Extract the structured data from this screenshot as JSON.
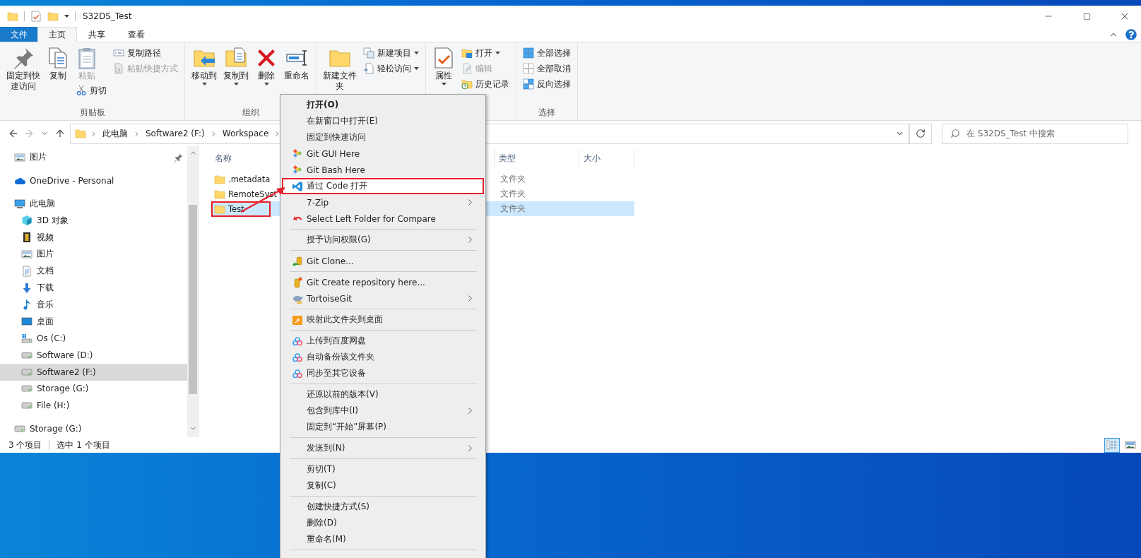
{
  "window": {
    "title": "S32DS_Test"
  },
  "tabs": [
    {
      "label": "文件",
      "kind": "file",
      "selected": false
    },
    {
      "label": "主页",
      "kind": "tab",
      "selected": true
    },
    {
      "label": "共享",
      "kind": "tab",
      "selected": false
    },
    {
      "label": "查看",
      "kind": "tab",
      "selected": false
    }
  ],
  "ribbon": {
    "groups": [
      {
        "label": "剪贴板",
        "columns": [
          [
            {
              "label": "固定到快速访问",
              "kind": "pin",
              "large": true,
              "dropdown": false,
              "disabled": false
            }
          ],
          [
            {
              "label": "复制",
              "kind": "copy",
              "large": true,
              "dropdown": false,
              "disabled": false
            }
          ],
          [
            {
              "label": "粘贴",
              "kind": "paste",
              "large": true,
              "dropdown": false,
              "disabled": true
            },
            {
              "label": "剪切",
              "kind": "cut",
              "large": false,
              "dropdown": false,
              "disabled": false
            }
          ],
          [
            {
              "label": "复制路径",
              "kind": "path",
              "large": false,
              "dropdown": false,
              "disabled": false
            },
            {
              "label": "粘贴快捷方式",
              "kind": "shortcut",
              "large": false,
              "dropdown": false,
              "disabled": true
            }
          ]
        ]
      },
      {
        "label": "组织",
        "columns": [
          [
            {
              "label": "移动到",
              "kind": "move",
              "large": true,
              "dropdown": true,
              "disabled": false
            }
          ],
          [
            {
              "label": "复制到",
              "kind": "copyto",
              "large": true,
              "dropdown": true,
              "disabled": false
            }
          ],
          [
            {
              "label": "删除",
              "kind": "delete",
              "large": true,
              "dropdown": true,
              "disabled": false
            }
          ],
          [
            {
              "label": "重命名",
              "kind": "rename",
              "large": true,
              "dropdown": false,
              "disabled": false
            }
          ]
        ]
      },
      {
        "columns": [
          [
            {
              "label": "新建文件夹",
              "kind": "newfolder",
              "large": true,
              "dropdown": false,
              "disabled": false
            }
          ],
          [
            {
              "label": "新建项目",
              "kind": "newitem",
              "large": false,
              "dropdown": true,
              "disabled": false
            },
            {
              "label": "轻松访问",
              "kind": "easyaccess",
              "large": false,
              "dropdown": true,
              "disabled": false
            }
          ]
        ]
      },
      {
        "columns": [
          [
            {
              "label": "属性",
              "kind": "properties",
              "large": true,
              "dropdown": true,
              "disabled": false
            }
          ],
          [
            {
              "label": "打开",
              "kind": "open",
              "large": false,
              "dropdown": true,
              "disabled": false
            },
            {
              "label": "编辑",
              "kind": "edit",
              "large": false,
              "dropdown": false,
              "disabled": true
            },
            {
              "label": "历史记录",
              "kind": "history",
              "large": false,
              "dropdown": false,
              "disabled": false
            }
          ]
        ]
      },
      {
        "label": "选择",
        "columns": [
          [
            {
              "label": "全部选择",
              "kind": "selectall",
              "large": false,
              "dropdown": false,
              "disabled": false
            },
            {
              "label": "全部取消",
              "kind": "selectnone",
              "large": false,
              "dropdown": false,
              "disabled": false
            },
            {
              "label": "反向选择",
              "kind": "invert",
              "large": false,
              "dropdown": false,
              "disabled": false
            }
          ]
        ]
      }
    ]
  },
  "address": {
    "crumbs": [
      "此电脑",
      "Software2 (F:)",
      "Workspace"
    ]
  },
  "search": {
    "placeholder": "在 S32DS_Test 中搜索"
  },
  "nav": {
    "items": [
      {
        "label": "图片",
        "kind": "pictures",
        "pinned": true,
        "selected": false
      },
      {
        "label": "OneDrive - Personal",
        "kind": "cloud",
        "pinned": false,
        "selected": false
      },
      {
        "label": "此电脑",
        "kind": "pc",
        "pinned": false,
        "selected": false,
        "children": [
          {
            "label": "3D 对象",
            "kind": "cube",
            "selected": false
          },
          {
            "label": "视频",
            "kind": "video",
            "selected": false
          },
          {
            "label": "图片",
            "kind": "pictures",
            "selected": false
          },
          {
            "label": "文档",
            "kind": "docs",
            "selected": false
          },
          {
            "label": "下载",
            "kind": "download",
            "selected": false
          },
          {
            "label": "音乐",
            "kind": "music",
            "selected": false
          },
          {
            "label": "桌面",
            "kind": "desktop",
            "selected": false
          },
          {
            "label": "Os (C:)",
            "kind": "osdrive",
            "selected": false
          },
          {
            "label": "Software (D:)",
            "kind": "drive",
            "selected": false
          },
          {
            "label": "Software2 (F:)",
            "kind": "drive",
            "selected": true
          },
          {
            "label": "Storage (G:)",
            "kind": "drive",
            "selected": false
          },
          {
            "label": "File (H:)",
            "kind": "drive",
            "selected": false
          }
        ]
      },
      {
        "label": "Storage (G:)",
        "kind": "drive",
        "pinned": false,
        "selected": false
      }
    ]
  },
  "files": {
    "columns": [
      "名称",
      "类型",
      "大小"
    ],
    "rows": [
      {
        "name": ".metadata",
        "type": "文件夹",
        "selected": false,
        "annotated": false
      },
      {
        "name": "RemoteSyst",
        "type": "文件夹",
        "selected": false,
        "annotated": false
      },
      {
        "name": "Test",
        "type": "文件夹",
        "selected": true,
        "annotated": true
      }
    ]
  },
  "status_bar": {
    "count": "3 个项目",
    "selection": "选中 1 个项目",
    "views": [
      {
        "kind": "details",
        "selected": true
      },
      {
        "kind": "large",
        "selected": false
      }
    ]
  },
  "context_menu": {
    "groups": [
      [
        {
          "label": "打开(O)",
          "kind": "plain",
          "default": true,
          "submenu": false,
          "selected": false,
          "annotated": false
        },
        {
          "label": "在新窗口中打开(E)",
          "kind": "plain",
          "default": false,
          "submenu": false,
          "selected": false,
          "annotated": false
        },
        {
          "label": "固定到快速访问",
          "kind": "plain",
          "default": false,
          "submenu": false,
          "selected": false,
          "annotated": false
        },
        {
          "label": "Git GUI Here",
          "kind": "git",
          "default": false,
          "submenu": false,
          "selected": false,
          "annotated": false
        },
        {
          "label": "Git Bash Here",
          "kind": "git",
          "default": false,
          "submenu": false,
          "selected": false,
          "annotated": false
        },
        {
          "label": "通过 Code 打开",
          "kind": "vscode",
          "default": false,
          "submenu": false,
          "selected": true,
          "annotated": true
        },
        {
          "label": "7-Zip",
          "kind": "plain",
          "default": false,
          "submenu": true,
          "selected": false,
          "annotated": false
        },
        {
          "label": "Select Left Folder for Compare",
          "kind": "compare",
          "default": false,
          "submenu": false,
          "selected": false,
          "annotated": false
        }
      ],
      [
        {
          "label": "授予访问权限(G)",
          "kind": "plain",
          "default": false,
          "submenu": true,
          "selected": false,
          "annotated": false
        }
      ],
      [
        {
          "label": "Git Clone...",
          "kind": "clone",
          "default": false,
          "submenu": false,
          "selected": false,
          "annotated": false
        }
      ],
      [
        {
          "label": "Git Create repository here...",
          "kind": "repo",
          "default": false,
          "submenu": false,
          "selected": false,
          "annotated": false
        },
        {
          "label": "TortoiseGit",
          "kind": "tortoise",
          "default": false,
          "submenu": true,
          "selected": false,
          "annotated": false
        }
      ],
      [
        {
          "label": "映射此文件夹到桌面",
          "kind": "mapfolder",
          "default": false,
          "submenu": false,
          "selected": false,
          "annotated": false
        }
      ],
      [
        {
          "label": "上传到百度网盘",
          "kind": "baidu",
          "default": false,
          "submenu": false,
          "selected": false,
          "annotated": false
        },
        {
          "label": "自动备份该文件夹",
          "kind": "baidu",
          "default": false,
          "submenu": false,
          "selected": false,
          "annotated": false
        },
        {
          "label": "同步至其它设备",
          "kind": "baidu",
          "default": false,
          "submenu": false,
          "selected": false,
          "annotated": false
        }
      ],
      [
        {
          "label": "还原以前的版本(V)",
          "kind": "plain",
          "default": false,
          "submenu": false,
          "selected": false,
          "annotated": false
        },
        {
          "label": "包含到库中(I)",
          "kind": "plain",
          "default": false,
          "submenu": true,
          "selected": false,
          "annotated": false
        },
        {
          "label": "固定到“开始”屏幕(P)",
          "kind": "plain",
          "default": false,
          "submenu": false,
          "selected": false,
          "annotated": false
        }
      ],
      [
        {
          "label": "发送到(N)",
          "kind": "plain",
          "default": false,
          "submenu": true,
          "selected": false,
          "annotated": false
        }
      ],
      [
        {
          "label": "剪切(T)",
          "kind": "plain",
          "default": false,
          "submenu": false,
          "selected": false,
          "annotated": false
        },
        {
          "label": "复制(C)",
          "kind": "plain",
          "default": false,
          "submenu": false,
          "selected": false,
          "annotated": false
        }
      ],
      [
        {
          "label": "创建快捷方式(S)",
          "kind": "plain",
          "default": false,
          "submenu": false,
          "selected": false,
          "annotated": false
        },
        {
          "label": "删除(D)",
          "kind": "plain",
          "default": false,
          "submenu": false,
          "selected": false,
          "annotated": false
        },
        {
          "label": "重命名(M)",
          "kind": "plain",
          "default": false,
          "submenu": false,
          "selected": false,
          "annotated": false
        }
      ]
    ]
  }
}
